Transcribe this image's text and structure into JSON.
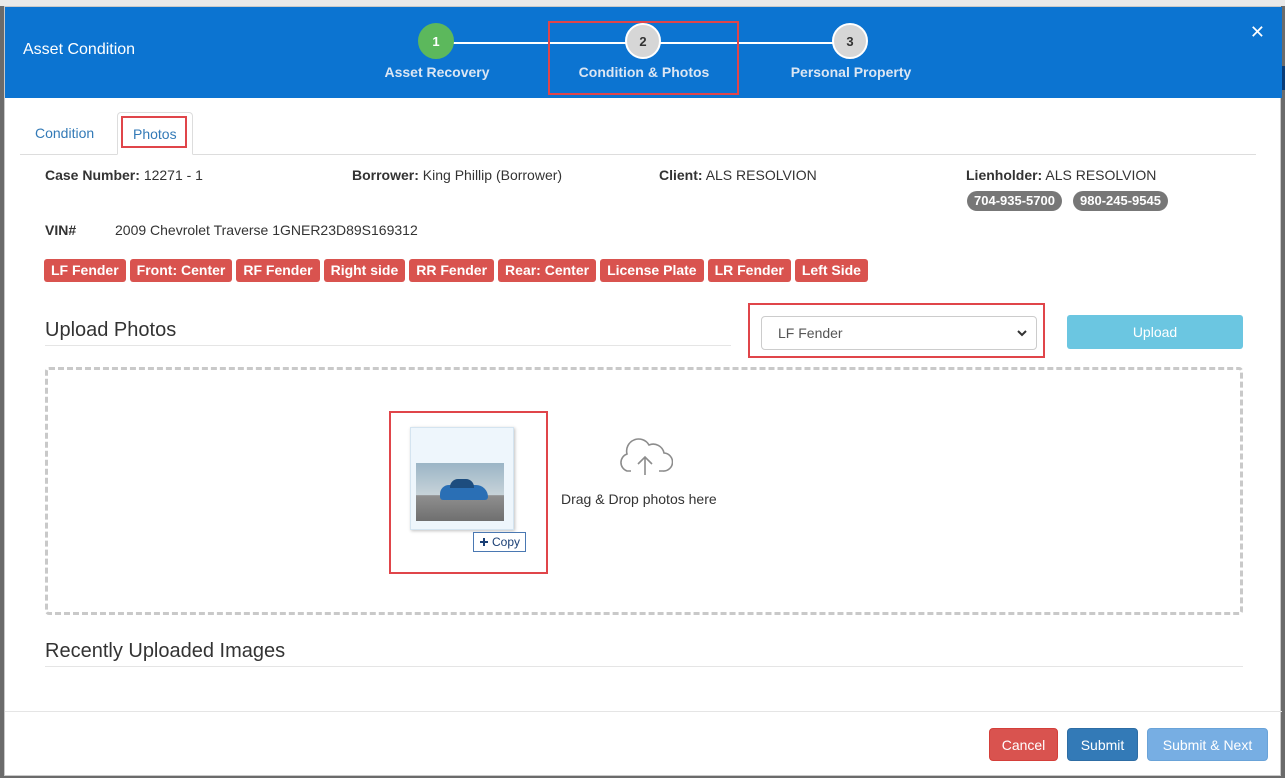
{
  "modal": {
    "title": "Asset Condition",
    "close_glyph": "✕"
  },
  "stepper": {
    "steps": [
      {
        "number": "1",
        "label": "Asset Recovery",
        "state": "complete"
      },
      {
        "number": "2",
        "label": "Condition & Photos",
        "state": "current"
      },
      {
        "number": "3",
        "label": "Personal Property",
        "state": "pending"
      }
    ]
  },
  "tabs": [
    {
      "label": "Condition",
      "active": false
    },
    {
      "label": "Photos",
      "active": true
    }
  ],
  "case": {
    "case_number_label": "Case Number:",
    "case_number": "12271 - 1",
    "borrower_label": "Borrower:",
    "borrower": "King Phillip (Borrower)",
    "client_label": "Client:",
    "client": "ALS RESOLVION",
    "lienholder_label": "Lienholder:",
    "lienholder": "ALS RESOLVION",
    "phones": [
      "704-935-5700",
      "980-245-9545"
    ],
    "vin_label": "VIN#",
    "vin_value": "2009 Chevrolet Traverse 1GNER23D89S169312"
  },
  "damage_tags": [
    "LF Fender",
    "Front: Center",
    "RF Fender",
    "Right side",
    "RR Fender",
    "Rear: Center",
    "License Plate",
    "LR Fender",
    "Left Side"
  ],
  "upload": {
    "title": "Upload Photos",
    "selected_location": "LF Fender",
    "upload_button": "Upload",
    "drop_text": "Drag & Drop photos here",
    "copy_label": "Copy"
  },
  "recent": {
    "title": "Recently Uploaded Images"
  },
  "footer": {
    "cancel": "Cancel",
    "submit": "Submit",
    "submit_next": "Submit & Next"
  },
  "colors": {
    "header": "#0c74d1",
    "step_complete": "#5cb85c",
    "tag": "#d9534f",
    "highlight": "#e0454a"
  }
}
